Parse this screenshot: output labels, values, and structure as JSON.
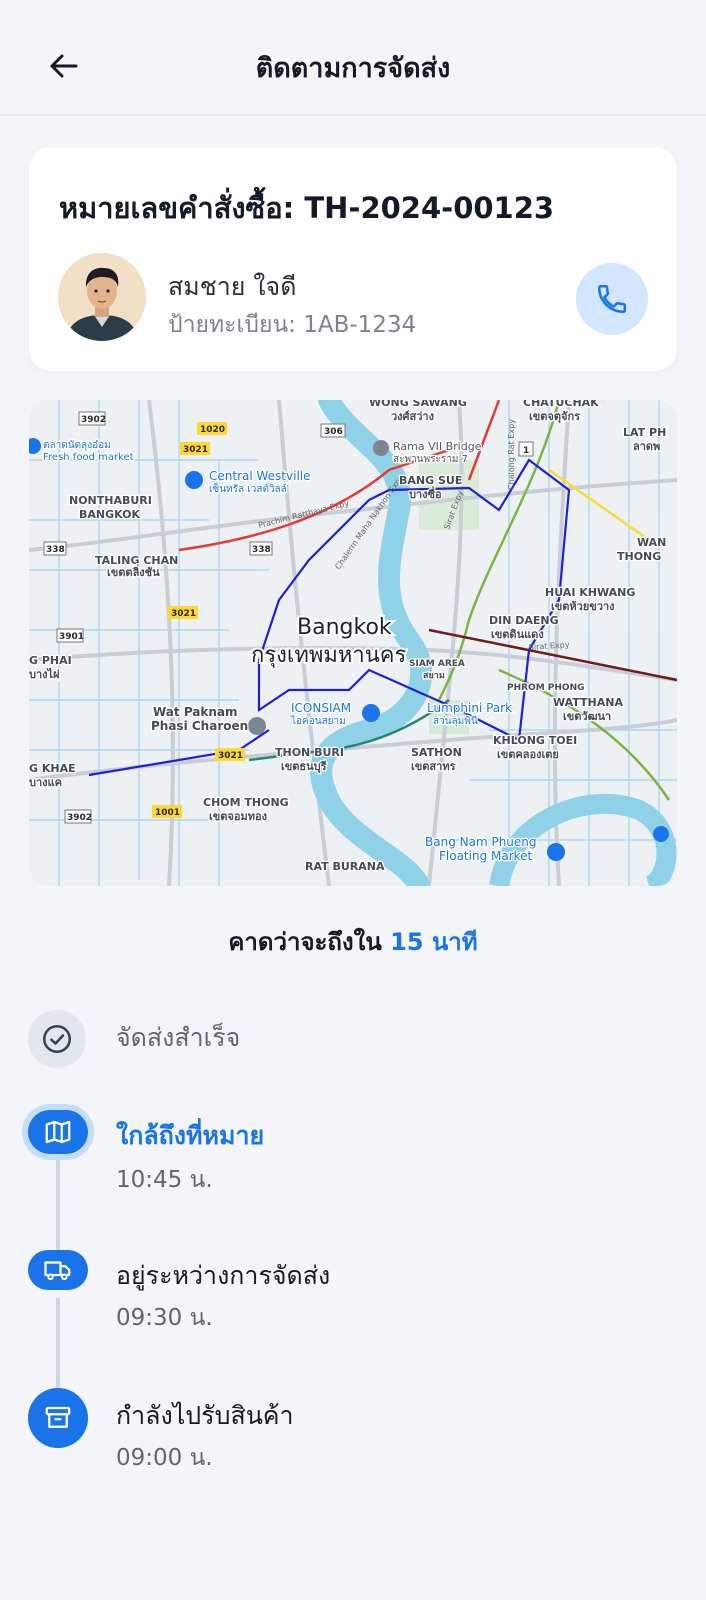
{
  "header": {
    "title": "ติดตามการจัดส่ง",
    "back_icon": "arrow-left-icon"
  },
  "order": {
    "number_label": "หมายเลขคำสั่งซื้อ: TH-2024-00123",
    "driver_name": "สมชาย ใจดี",
    "plate_label": "ป้ายทะเบียน: 1AB-1234",
    "call_icon": "phone-icon"
  },
  "map": {
    "city_en": "Bangkok",
    "city_th": "กรุงเทพมหานคร",
    "places": [
      {
        "en": "WONG SAWANG",
        "th": "วงศ์สว่าง"
      },
      {
        "en": "CHATUCHAK",
        "th": "เขตจตุจักร"
      },
      {
        "en": "LAT PH",
        "th": "ลาดพ"
      },
      {
        "en": "Rama VII Bridge",
        "th": "สะพานพระราม 7"
      },
      {
        "en": "ตลาดนัดลุงอ๋อม",
        "th": "Fresh food market"
      },
      {
        "en": "Central Westville",
        "th": "เซ็นทรัล เวสต์วิลล์"
      },
      {
        "en": "NONTHABURI",
        "th": "BANGKOK"
      },
      {
        "en": "BANG SUE",
        "th": "บางซื่อ"
      },
      {
        "en": "TALING CHAN",
        "th": "เขตตลิ่งชัน"
      },
      {
        "en": "WAN",
        "th": "THONG"
      },
      {
        "en": "HUAI KHWANG",
        "th": "เขตห้วยขวาง"
      },
      {
        "en": "DIN DAENG",
        "th": "เขตดินแดง"
      },
      {
        "en": "G PHAI",
        "th": "บางไผ่"
      },
      {
        "en": "SIAM AREA",
        "th": "สยาม"
      },
      {
        "en": "PHROM PHONG",
        "th": ""
      },
      {
        "en": "WATTHANA",
        "th": "เขตวัฒนา"
      },
      {
        "en": "Wat Paknam",
        "th": "Phasi Charoen"
      },
      {
        "en": "ICONSIAM",
        "th": "ไอคอนสยาม"
      },
      {
        "en": "Lumphini Park",
        "th": "สวนลุมพินี"
      },
      {
        "en": "THON BURI",
        "th": "เขตธนบุรี"
      },
      {
        "en": "SATHON",
        "th": "เขตสาทร"
      },
      {
        "en": "KHLONG TOEI",
        "th": "เขตคลองเตย"
      },
      {
        "en": "CHOM THONG",
        "th": "เขตจอมทอง"
      },
      {
        "en": "Bang Nam Phueng",
        "th": "Floating Market"
      },
      {
        "en": "RAT BURANA",
        "th": ""
      },
      {
        "en": "G KHAE",
        "th": "บางแค"
      }
    ],
    "road_shields": [
      "3902",
      "1020",
      "306",
      "3021",
      "338",
      "338",
      "3021",
      "3901",
      "3021",
      "1001",
      "3902",
      "1"
    ],
    "road_labels": [
      "Prachim Ratthaya Expy",
      "Chalerm Maha Nakhon Expy",
      "Sirat Expy",
      "Sirat Expy",
      "Chalong Rat Expy"
    ]
  },
  "eta": {
    "prefix": "คาดว่าจะถึงใน",
    "value": "15 นาที"
  },
  "timeline": [
    {
      "title": "จัดส่งสำเร็จ",
      "time": "",
      "status": "done",
      "icon": "check-circle-icon"
    },
    {
      "title": "ใกล้ถึงที่หมาย",
      "time": "10:45 น.",
      "status": "current",
      "icon": "map-icon"
    },
    {
      "title": "อยู่ระหว่างการจัดส่ง",
      "time": "09:30 น.",
      "status": "completed",
      "icon": "truck-icon"
    },
    {
      "title": "กำลังไปรับสินค้า",
      "time": "09:00 น.",
      "status": "completed",
      "icon": "archive-box-icon"
    }
  ],
  "colors": {
    "accent": "#1a73e8",
    "background": "#f3f5f8",
    "text": "#141a28",
    "muted": "#7a8290"
  }
}
